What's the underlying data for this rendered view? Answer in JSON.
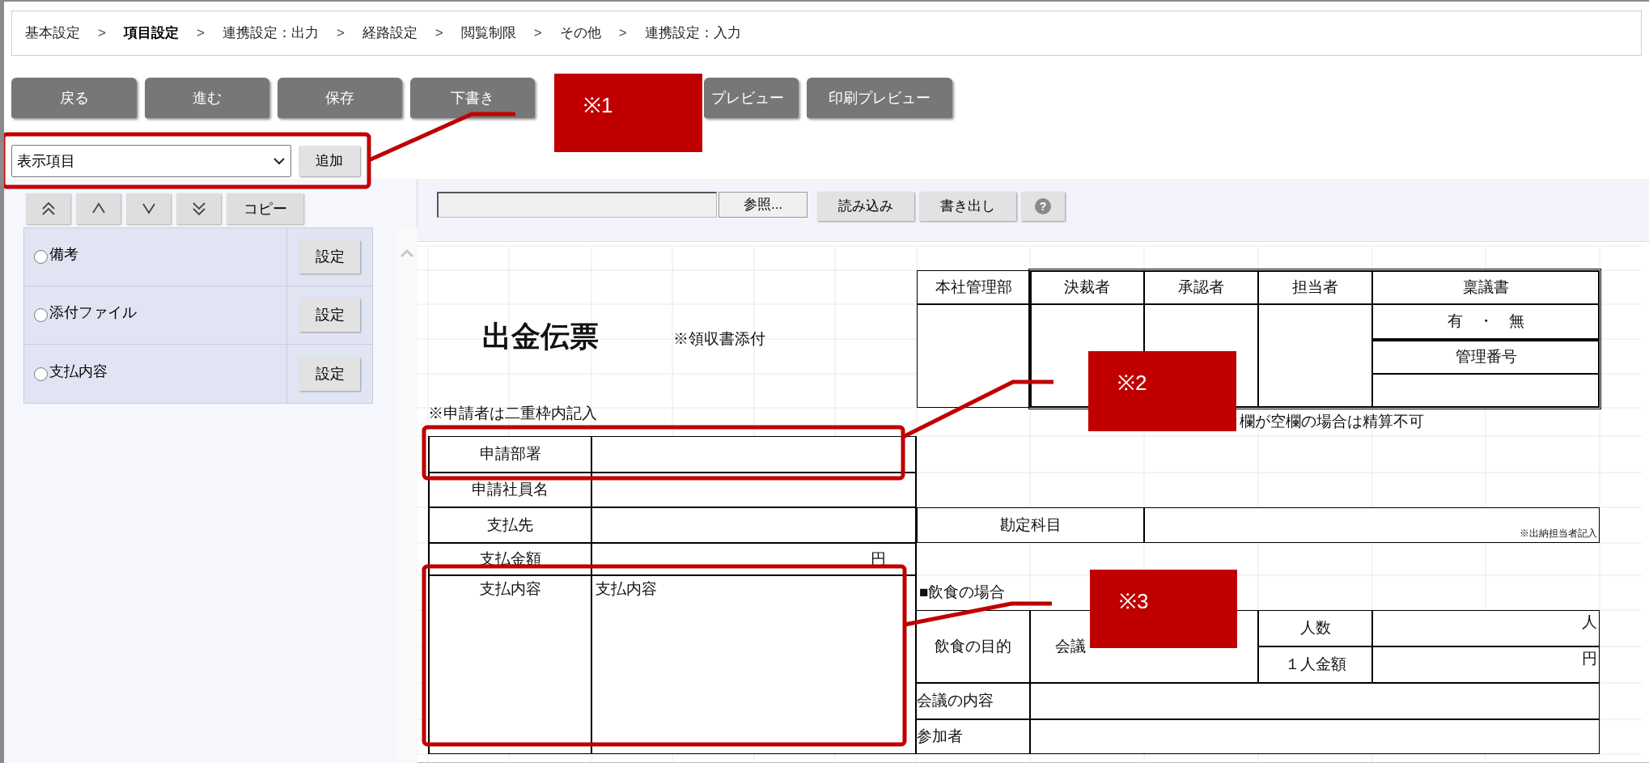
{
  "breadcrumb": [
    {
      "label": "基本設定",
      "selected": false,
      "separator": ">"
    },
    {
      "label": "項目設定",
      "selected": true,
      "separator": ">"
    },
    {
      "label": "連携設定：出力",
      "selected": false,
      "separator": ">"
    },
    {
      "label": "経路設定",
      "selected": false,
      "separator": ">"
    },
    {
      "label": "閲覧制限",
      "selected": false,
      "separator": ">"
    },
    {
      "label": "その他",
      "selected": false,
      "separator": ">"
    },
    {
      "label": "連携設定：入力",
      "selected": false
    }
  ],
  "buttons": [
    "戻る",
    "進む",
    "保存",
    "下書き",
    "プレビュー",
    "印刷プレビュー"
  ],
  "item_select": {
    "value": "表示項目"
  },
  "add_button": "追加",
  "copy_button": "コピー",
  "items": [
    {
      "label": "備考",
      "selected": false,
      "button": "設定"
    },
    {
      "label": "添付ファイル",
      "selected": false,
      "button": "設定"
    },
    {
      "label": "支払内容",
      "selected": false,
      "button": "設定"
    }
  ],
  "file_bar": {
    "browse_button": "参照...",
    "import_button": "読み込み",
    "export_button": "書き出し",
    "help_button": "?"
  },
  "sheet": {
    "title": "出金伝票",
    "receipt_note": "※領収書添付",
    "approval": {
      "headers": [
        "本社管理部",
        "決裁者",
        "承認者",
        "担当者",
        "稟議書"
      ],
      "ringi_choice": "有　・　無",
      "control_number_label": "管理番号"
    },
    "applicant_note": "※申請者は二重枠内記入",
    "settlement_note": "欄が空欄の場合は精算不可",
    "applicant_rows": [
      {
        "label": "申請部署"
      },
      {
        "label": "申請社員名"
      },
      {
        "label": "支払先"
      },
      {
        "label": "支払金額",
        "unit": "円"
      },
      {
        "label": "支払内容",
        "value": "支払内容"
      }
    ],
    "account": {
      "label": "勘定科目",
      "note": "※出納担当者記入"
    },
    "dining": {
      "heading": "■飲食の場合",
      "purpose_label": "飲食の目的",
      "purpose_value": "会議",
      "people_label": "人数",
      "people_unit": "人",
      "per_person_label": "１人金額",
      "per_person_unit": "円",
      "content_label": "会議の内容",
      "attendees_label": "参加者"
    }
  },
  "callouts": [
    "※1",
    "※2",
    "※3"
  ]
}
